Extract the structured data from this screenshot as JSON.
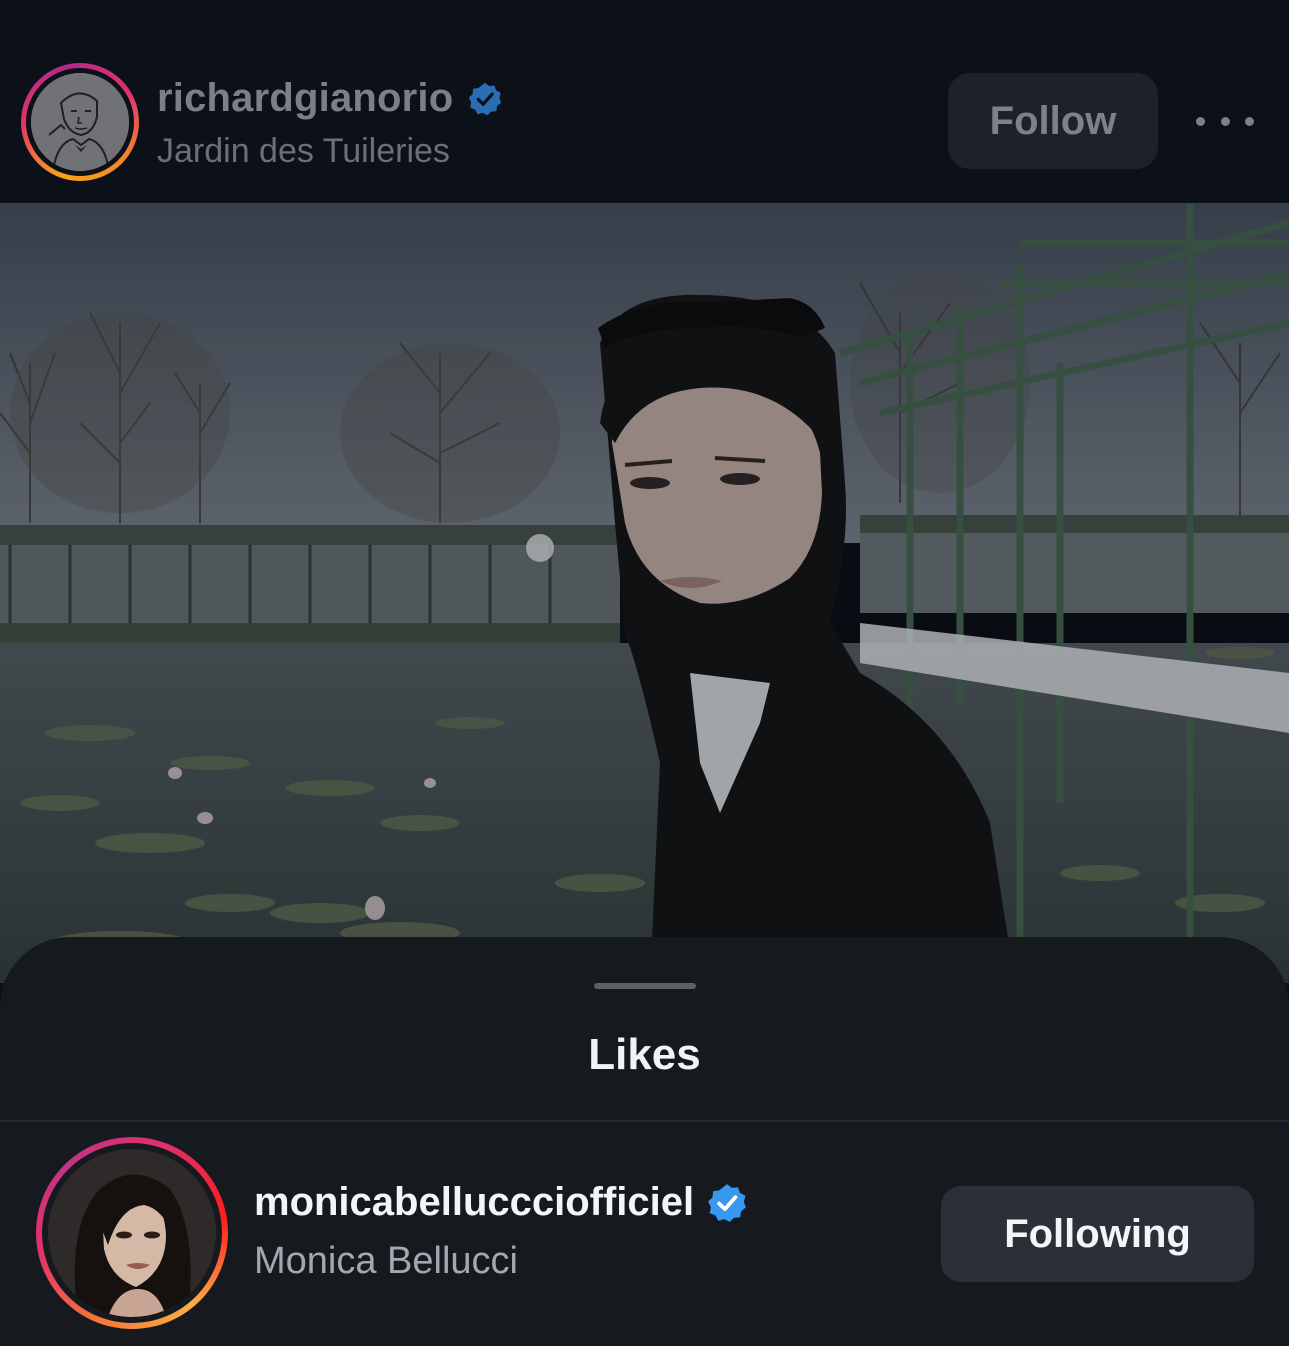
{
  "post": {
    "author_username": "richardgianorio",
    "author_verified": true,
    "location": "Jardin des Tuileries",
    "follow_label": "Follow",
    "more_icon": "more-horizontal-icon"
  },
  "likes_sheet": {
    "title": "Likes",
    "likers": [
      {
        "username": "monicabelluccciofficiel",
        "full_name": "Monica Bellucci",
        "verified": true,
        "button_label": "Following"
      }
    ]
  },
  "colors": {
    "verified_blue": "#3897f0",
    "story_ring_start": "#fcaf45",
    "story_ring_end": "#c13584"
  }
}
